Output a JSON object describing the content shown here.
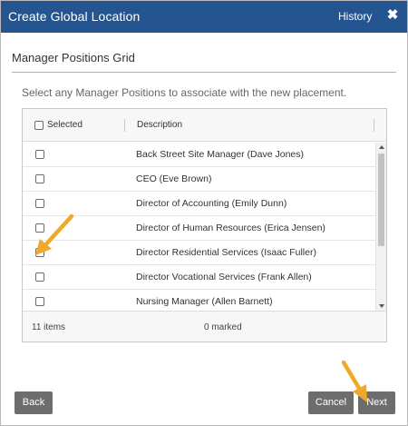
{
  "dialog": {
    "title": "Create Global Location",
    "history_label": "History",
    "close_glyph": "✖"
  },
  "section": {
    "title": "Manager Positions Grid",
    "instruction": "Select any Manager Positions to associate with the new placement."
  },
  "grid": {
    "columns": {
      "selected": "Selected",
      "description": "Description"
    },
    "rows": [
      {
        "description": "Back Street Site Manager (Dave Jones)",
        "checked": false
      },
      {
        "description": "CEO (Eve Brown)",
        "checked": false
      },
      {
        "description": "Director of Accounting (Emily Dunn)",
        "checked": false
      },
      {
        "description": "Director of Human Resources (Erica Jensen)",
        "checked": false
      },
      {
        "description": "Director Residential Services (Isaac Fuller)",
        "checked": false
      },
      {
        "description": "Director Vocational Services (Frank Allen)",
        "checked": false
      },
      {
        "description": "Nursing Manager (Allen Barnett)",
        "checked": false
      }
    ],
    "footer": {
      "count": "11 items",
      "marked": "0 marked"
    }
  },
  "buttons": {
    "back": "Back",
    "cancel": "Cancel",
    "next": "Next"
  },
  "colors": {
    "titlebar": "#245591",
    "button": "#6d6d6d",
    "arrow": "#f0a828"
  }
}
